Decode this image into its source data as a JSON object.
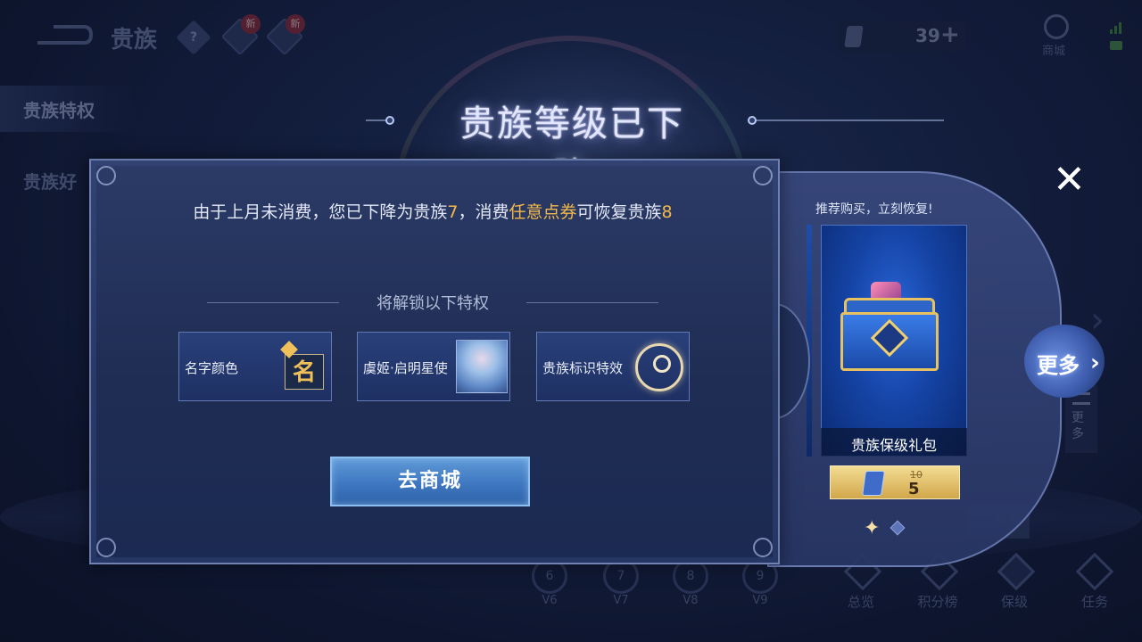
{
  "topbar": {
    "title": "贵族",
    "help_symbol": "?",
    "new_badge": "新",
    "currency_value": "39",
    "plus_symbol": "+",
    "shop_label": "商城"
  },
  "sidebar": {
    "items": [
      {
        "label": "贵族特权"
      },
      {
        "label": "贵族好"
      }
    ]
  },
  "dialog": {
    "title": "贵族等级已下降",
    "message_part1": "由于上月未消费，您已下降为贵族",
    "message_level_current": "7",
    "message_part2": "，消费",
    "message_highlight": "任意点券",
    "message_part3": "可恢复贵族",
    "message_level_target": "8",
    "section_label": "将解锁以下特权",
    "privileges": [
      {
        "label": "名字颜色",
        "icon_text": "名",
        "icon": "name-color-icon"
      },
      {
        "label": "虞姬·启明星使",
        "icon": "hero-skin-portrait"
      },
      {
        "label": "贵族标识特效",
        "icon": "noble-crest-icon"
      }
    ],
    "go_shop_label": "去商城"
  },
  "recommend": {
    "title": "推荐购买，立刻恢复!",
    "item_name": "贵族保级礼包",
    "price_old": "10",
    "price_new": "5",
    "more_label": "更多",
    "more_chevron": "›"
  },
  "close_symbol": "✕",
  "background": {
    "more_vertical": "更多",
    "restore_tag": "恢复",
    "levels": [
      {
        "badge": "6",
        "label": "V6"
      },
      {
        "badge": "7",
        "label": "V7"
      },
      {
        "badge": "8",
        "label": "V8"
      },
      {
        "badge": "9",
        "label": "V9"
      }
    ],
    "nav": [
      {
        "label": "总览"
      },
      {
        "label": "积分榜"
      },
      {
        "label": "保级"
      },
      {
        "label": "任务"
      }
    ]
  },
  "colors": {
    "highlight": "#f2b84a",
    "button_blue": "#3f78c0",
    "price_gold": "#d1a74a"
  }
}
